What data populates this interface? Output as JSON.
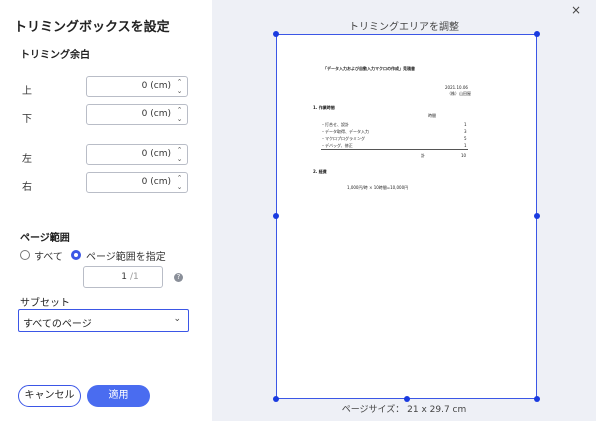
{
  "left_panel": {
    "title": "トリミングボックスを設定",
    "margin_section": "トリミング余白",
    "margins": [
      {
        "label": "上",
        "value": "0 (cm)"
      },
      {
        "label": "下",
        "value": "0 (cm)"
      },
      {
        "label": "左",
        "value": "0 (cm)"
      },
      {
        "label": "右",
        "value": "0 (cm)"
      }
    ],
    "page_range_section": "ページ範囲",
    "radio_all": "すべて",
    "radio_specify": "ページ範囲を指定",
    "page_current": "1",
    "page_total": "/1",
    "help": "?",
    "subset_section": "サブセット",
    "subset_value": "すべてのページ",
    "cancel": "キャンセル",
    "apply": "適用"
  },
  "right_panel": {
    "trim_area_title": "トリミングエリアを調整",
    "page_size": "ページサイズ： 21 x 29.7 cm",
    "close": "×"
  },
  "document": {
    "heading": "「データ入力および自動入力マクロの作成」見積書",
    "date": "2021.10.06",
    "company": "（株）山田屋",
    "sec1": "1. 作業時間",
    "time_header": "時間",
    "items": [
      {
        "name": "・打合せ、設計",
        "hours": "1"
      },
      {
        "name": "・データ取得、データ入力",
        "hours": "3"
      },
      {
        "name": "・マクロプログラミング",
        "hours": "5"
      },
      {
        "name": "・デバッグ、修正",
        "hours": "1"
      }
    ],
    "total_label": "計",
    "total_value": "10",
    "sec2": "2. 経費",
    "cost": "1,000円/時 × 10時間=10,000円"
  },
  "colors": {
    "accent": "#3b56e6",
    "apply_bg": "#4a6cf0",
    "preview_bg": "#eef0f6"
  }
}
